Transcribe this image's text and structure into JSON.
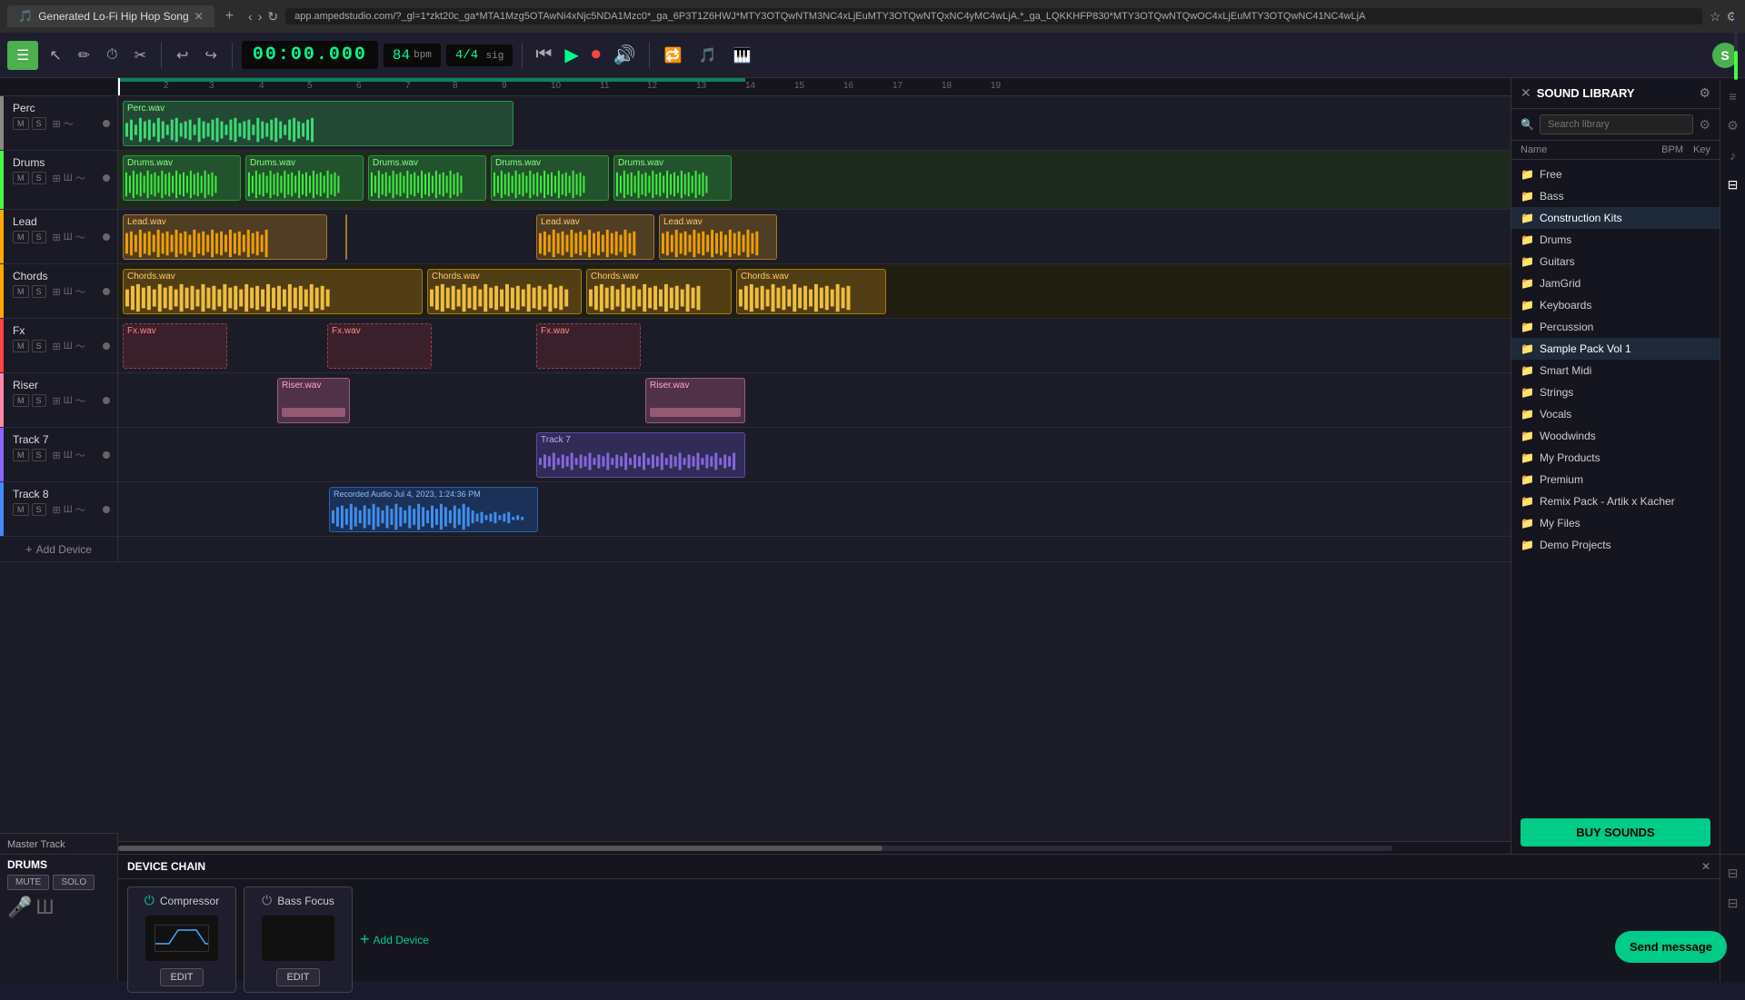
{
  "browser": {
    "tab_title": "Generated Lo-Fi Hip Hop Song",
    "url": "app.ampedstudio.com/?_gl=1*zkt20c_ga*MTA1Mzg5OTAwNi4xNjc5NDA1Mzc0*_ga_6P3T1Z6HWJ*MTY3OTQwNTM3NC4xLjEuMTY3OTQwNTQxNC4yMC4wLjA.*_ga_LQKKHFP830*MTY3OTQwNTQwOC4xLjEuMTY3OTQwNC41NC4wLjA"
  },
  "toolbar": {
    "menu_icon": "☰",
    "time": "00:00.000",
    "bpm": "84",
    "bpm_label": "bpm",
    "sig": "4/4",
    "sig_label": "sig",
    "user_initial": "S"
  },
  "tracks": [
    {
      "name": "Perc",
      "color": "#888888",
      "type": "perc"
    },
    {
      "name": "Drums",
      "color": "#44ff44",
      "type": "drums"
    },
    {
      "name": "Lead",
      "color": "#ffaa00",
      "type": "lead"
    },
    {
      "name": "Chords",
      "color": "#ffaa00",
      "type": "chords"
    },
    {
      "name": "Fx",
      "color": "#ff4444",
      "type": "fx"
    },
    {
      "name": "Riser",
      "color": "#ff88aa",
      "type": "riser"
    },
    {
      "name": "Track 7",
      "color": "#8866ff",
      "type": "track7"
    },
    {
      "name": "Track 8",
      "color": "#4488ff",
      "type": "track8"
    }
  ],
  "library": {
    "title": "SOUND LIBRARY",
    "search_placeholder": "Search library",
    "col_name": "Name",
    "col_bpm": "BPM",
    "col_key": "Key",
    "items": [
      {
        "name": "Free",
        "type": "folder"
      },
      {
        "name": "Bass",
        "type": "folder"
      },
      {
        "name": "Construction Kits",
        "type": "folder",
        "highlight": true
      },
      {
        "name": "Drums",
        "type": "folder"
      },
      {
        "name": "Guitars",
        "type": "folder"
      },
      {
        "name": "JamGrid",
        "type": "folder"
      },
      {
        "name": "Keyboards",
        "type": "folder"
      },
      {
        "name": "Percussion",
        "type": "folder"
      },
      {
        "name": "Sample Pack Vol 1",
        "type": "folder",
        "highlight": true
      },
      {
        "name": "Smart Midi",
        "type": "folder"
      },
      {
        "name": "Strings",
        "type": "folder"
      },
      {
        "name": "Vocals",
        "type": "folder"
      },
      {
        "name": "Woodwinds",
        "type": "folder"
      },
      {
        "name": "My Products",
        "type": "folder"
      },
      {
        "name": "Premium",
        "type": "folder"
      },
      {
        "name": "Remix Pack - Artik x Kacher",
        "type": "folder"
      },
      {
        "name": "My Files",
        "type": "folder"
      },
      {
        "name": "Demo Projects",
        "type": "folder"
      }
    ],
    "buy_btn": "BUY SOUNDS"
  },
  "device_chain": {
    "title": "DEVICE CHAIN",
    "section": "DRUMS",
    "compressor": "Compressor",
    "bass_focus": "Bass Focus",
    "edit_label": "EDIT",
    "add_device": "Add Device"
  },
  "bottom": {
    "track_name": "Master Track",
    "mute": "MUTE",
    "solo": "SOLO"
  },
  "send_message": "Send message"
}
